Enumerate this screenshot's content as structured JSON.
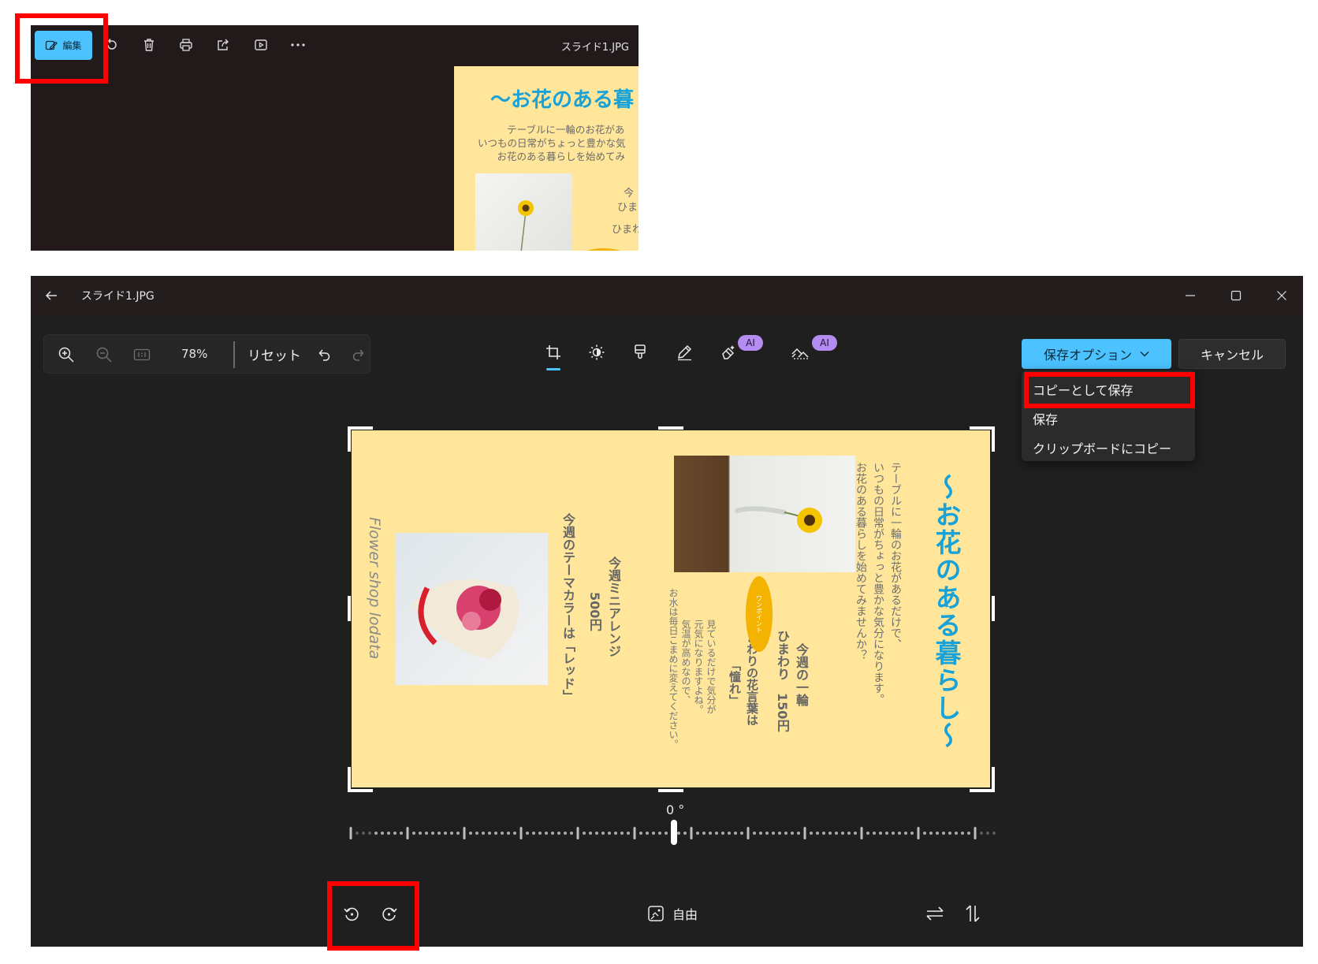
{
  "top_window": {
    "edit_label": "編集",
    "filename": "スライド1.JPG",
    "slide": {
      "title": "〜お花のある暮",
      "lines": [
        "テーブルに一輪のお花があ",
        "いつもの日常がちょっと豊かな気",
        "お花のある暮らしを始めてみ"
      ],
      "right_text_1": "今",
      "right_text_2": "ひま",
      "right_text_3": "ひまわ"
    },
    "icons": [
      "edit-icon",
      "rotate-icon",
      "delete-icon",
      "print-icon",
      "share-icon",
      "slideshow-icon",
      "more-icon"
    ]
  },
  "editor": {
    "title_bar": {
      "filename": "スライド1.JPG"
    },
    "zoom_panel": {
      "zoom": "78%",
      "reset_label": "リセット"
    },
    "tools": [
      "crop-icon",
      "brightness-icon",
      "filter-icon",
      "markup-icon",
      "erase-icon",
      "background-icon"
    ],
    "ai_badge": "AI",
    "save_options_label": "保存オプション",
    "cancel_label": "キャンセル",
    "save_menu": {
      "items": [
        "コピーとして保存",
        "保存",
        "クリップボードにコピー"
      ]
    },
    "slide": {
      "title": "〜お花のある暮らし〜",
      "intro": [
        "テーブルに一輪のお花があるだけで、",
        "いつもの日常がちょっと豊かな気分になります。",
        "お花のある暮らしを始めてみませんか？"
      ],
      "weekly_1": [
        "今週の一輪",
        "ひまわり　150円"
      ],
      "flower_word": [
        "ひまわりの花言葉は",
        "「憧れ」"
      ],
      "note": [
        "見ているだけで気分が",
        "元気になりますよね。",
        "気温が高めなので、",
        "お水は毎日こまめに変えてください。"
      ],
      "oval_text": "ワンポイント",
      "mini": [
        "今週ミニアレンジ",
        "500円"
      ],
      "theme": "今週のテーマカラーは「レッド」",
      "shop": "Flower shop lodata"
    },
    "angle": "0 °",
    "aspect_label": "自由"
  },
  "colors": {
    "accent": "#4cc2ff",
    "highlight": "#ff0000",
    "slide_bg": "#ffe69a",
    "title_blue": "#19a2d8",
    "ai_purple": "#b48cf2"
  }
}
